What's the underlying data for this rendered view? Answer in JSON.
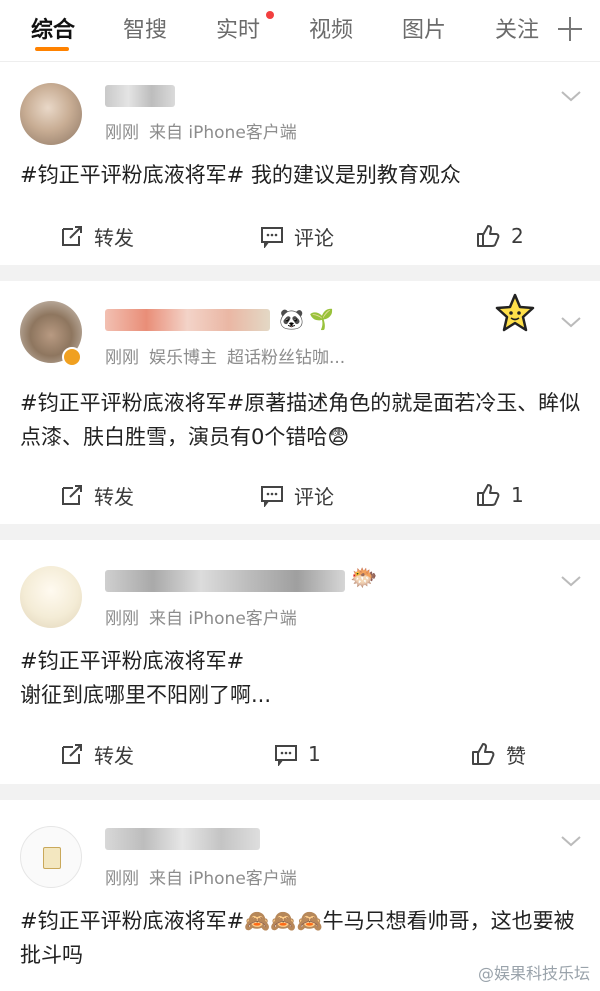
{
  "tabs": [
    {
      "label": "综合",
      "active": true
    },
    {
      "label": "智搜"
    },
    {
      "label": "实时",
      "badge": "red-dot"
    },
    {
      "label": "视频"
    },
    {
      "label": "图片"
    },
    {
      "label": "关注"
    }
  ],
  "posts": [
    {
      "time": "刚刚",
      "source": "来自 iPhone客户端",
      "hashtag": "#钧正平评粉底液将军#",
      "text": " 我的建议是别教育观众",
      "repost": "转发",
      "comment": "评论",
      "like": "2"
    },
    {
      "time": "刚刚",
      "source": "娱乐博主",
      "extra": "超话粉丝钻咖...",
      "hashtag": "#钧正平评粉底液将军#",
      "text": "原著描述角色的就是面若冷玉、眸似点漆、肤白胜雪，演员有0个错哈",
      "emoji": "😨",
      "repost": "转发",
      "comment": "评论",
      "like": "1"
    },
    {
      "time": "刚刚",
      "source": "来自 iPhone客户端",
      "hashtag": "#钧正平评粉底液将军#",
      "text": "谢征到底哪里不阳刚了啊...",
      "repost": "转发",
      "comment": "1",
      "like": "赞"
    },
    {
      "time": "刚刚",
      "source": "来自 iPhone客户端",
      "hashtag": "#钧正平评粉底液将军#",
      "emoji": "🙈🙈🙈",
      "text": "牛马只想看帅哥，这也要被批斗吗"
    }
  ],
  "watermark": "@娱果科技乐坛",
  "colors": {
    "accent": "#ff8200",
    "badge": "#f23f3f",
    "vip": "#f0a020"
  }
}
